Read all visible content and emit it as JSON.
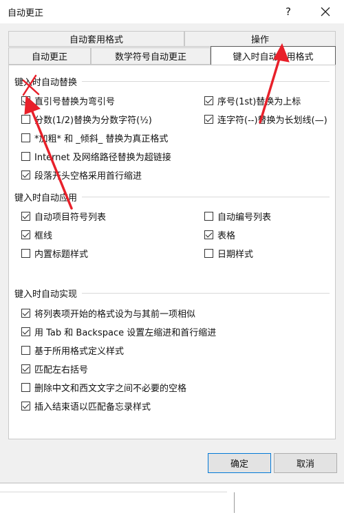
{
  "window": {
    "title": "自动更正",
    "help_label": "?",
    "close_label": "✕"
  },
  "tabs": {
    "row1": [
      "自动套用格式",
      "操作"
    ],
    "row2": [
      "自动更正",
      "数学符号自动更正",
      "键入时自动套用格式"
    ]
  },
  "sections": [
    {
      "label": "键入时自动替换",
      "options": [
        {
          "label": "直引号替换为弯引号",
          "checked": true
        },
        {
          "label": "分数(1/2)替换为分数字符(½)",
          "checked": false
        },
        {
          "label": "*加粗* 和 _倾斜_ 替换为真正格式",
          "checked": false
        },
        {
          "label": "Internet 及网络路径替换为超链接",
          "checked": false
        },
        {
          "label": "段落开头空格采用首行缩进",
          "checked": true
        },
        {
          "label": "序号(1st)替换为上标",
          "checked": true
        },
        {
          "label": "连字符(--)替换为长划线(—)",
          "checked": true
        }
      ]
    },
    {
      "label": "键入时自动应用",
      "options": [
        {
          "label": "自动项目符号列表",
          "checked": true
        },
        {
          "label": "框线",
          "checked": true
        },
        {
          "label": "内置标题样式",
          "checked": false
        },
        {
          "label": "自动编号列表",
          "checked": false
        },
        {
          "label": "表格",
          "checked": true
        },
        {
          "label": "日期样式",
          "checked": false
        }
      ]
    },
    {
      "label": "键入时自动实现",
      "options": [
        {
          "label": "将列表项开始的格式设为与其前一项相似",
          "checked": true
        },
        {
          "label": "用 Tab 和 Backspace 设置左缩进和首行缩进",
          "checked": true
        },
        {
          "label": "基于所用格式定义样式",
          "checked": false
        },
        {
          "label": "匹配左右括号",
          "checked": true
        },
        {
          "label": "删除中文和西文文字之间不必要的空格",
          "checked": false
        },
        {
          "label": "插入结束语以匹配备忘录样式",
          "checked": true
        }
      ]
    }
  ],
  "buttons": {
    "ok": "确定",
    "cancel": "取消"
  },
  "annotation_color": "#e8202a"
}
